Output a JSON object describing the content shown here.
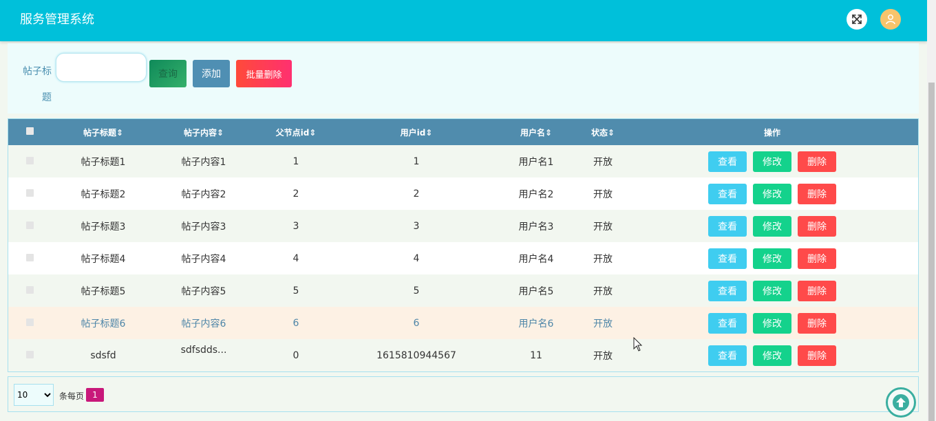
{
  "header": {
    "title": "服务管理系统",
    "fullscreen_icon": "expand-icon",
    "user_icon": "user-icon"
  },
  "search": {
    "label": "帖子标题",
    "placeholder": "",
    "search_label": "查询",
    "add_label": "添加",
    "batch_delete_label": "批量删除"
  },
  "table": {
    "columns": [
      "帖子标题",
      "帖子内容",
      "父节点id",
      "用户id",
      "用户名",
      "状态",
      "操作"
    ],
    "sort_icon": "⇕",
    "rows": [
      {
        "title": "帖子标题1",
        "content": "帖子内容1",
        "parent_id": "1",
        "user_id": "1",
        "username": "用户名1",
        "status": "开放"
      },
      {
        "title": "帖子标题2",
        "content": "帖子内容2",
        "parent_id": "2",
        "user_id": "2",
        "username": "用户名2",
        "status": "开放"
      },
      {
        "title": "帖子标题3",
        "content": "帖子内容3",
        "parent_id": "3",
        "user_id": "3",
        "username": "用户名3",
        "status": "开放"
      },
      {
        "title": "帖子标题4",
        "content": "帖子内容4",
        "parent_id": "4",
        "user_id": "4",
        "username": "用户名4",
        "status": "开放"
      },
      {
        "title": "帖子标题5",
        "content": "帖子内容5",
        "parent_id": "5",
        "user_id": "5",
        "username": "用户名5",
        "status": "开放"
      },
      {
        "title": "帖子标题6",
        "content": "帖子内容6",
        "parent_id": "6",
        "user_id": "6",
        "username": "用户名6",
        "status": "开放"
      },
      {
        "title": "sdsfd",
        "content": "sdfsdds...",
        "parent_id": "0",
        "user_id": "1615810944567",
        "username": "11",
        "status": "开放"
      }
    ],
    "actions": {
      "view": "查看",
      "edit": "修改",
      "delete": "删除"
    }
  },
  "pagination": {
    "page_size": "10",
    "page_size_options": [
      "10"
    ],
    "per_page_label": "条每页",
    "current_page": "1"
  },
  "colors": {
    "header": "#00c0da",
    "table_header": "#508cad",
    "view": "#3fcdf0",
    "edit": "#14d28c",
    "delete": "#ff4a4a",
    "page": "#c8187a"
  }
}
